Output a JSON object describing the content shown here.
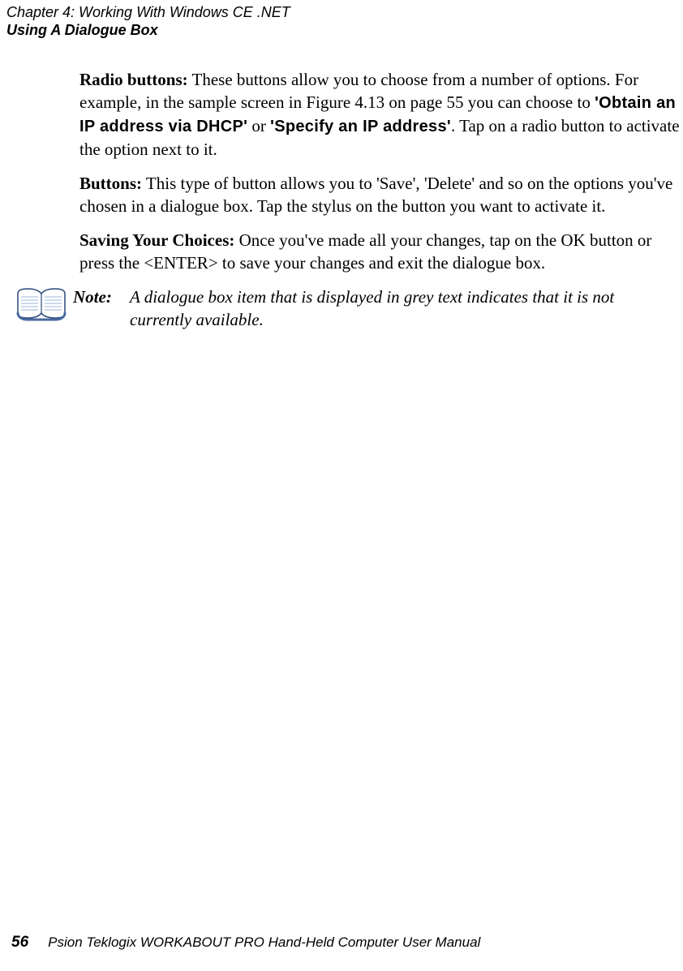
{
  "header": {
    "chapter": "Chapter  4:  Working With Windows CE .NET",
    "section": "Using A Dialogue Box"
  },
  "paragraphs": {
    "radio": {
      "label": "Radio buttons:",
      "t1": " These buttons allow you to choose from a number of options. For example, in the sample screen in Figure 4.13 on page 55 you can choose to ",
      "opt1": "'Obtain an IP address via DHCP'",
      "t2": " or ",
      "opt2": "'Specify an IP address'",
      "t3": ". Tap on a radio button to activate the option next to it."
    },
    "buttons": {
      "label": "Buttons:",
      "text": " This type of button allows you to 'Save', 'Delete' and so on the options you've chosen in a dialogue box. Tap the stylus on the button you want to activate it."
    },
    "saving": {
      "label": "Saving Your Choices:",
      "text": " Once you've made all your changes, tap on the OK button or press the <ENTER> to save your changes and exit the dialogue box."
    }
  },
  "note": {
    "label": "Note:",
    "line1": "A dialogue box item that is displayed in grey text indicates that it is not",
    "line2": "currently available."
  },
  "footer": {
    "page": "56",
    "title": "Psion Teklogix WORKABOUT PRO Hand-Held Computer User Manual"
  }
}
